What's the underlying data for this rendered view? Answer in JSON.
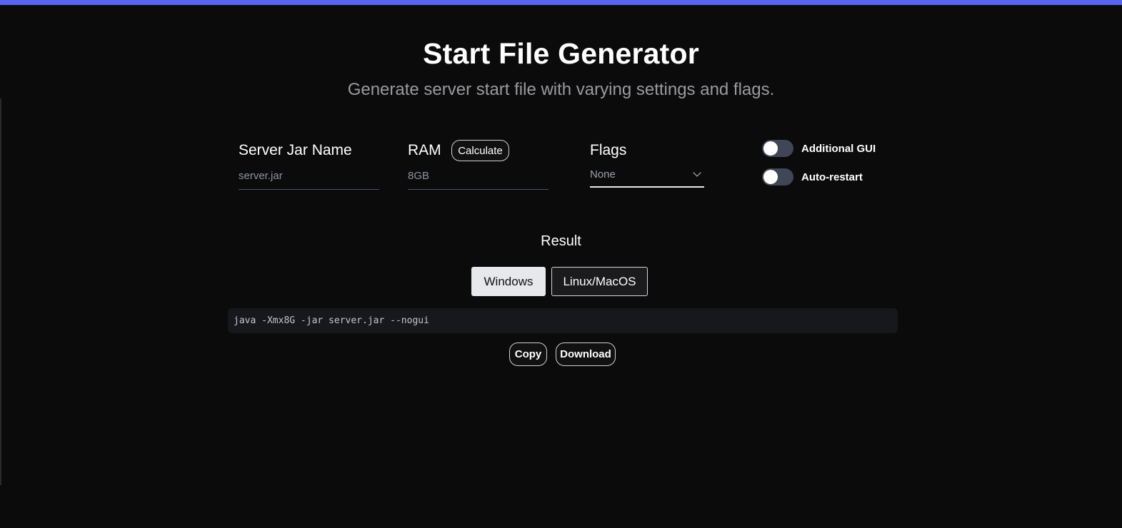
{
  "header": {
    "title": "Start File Generator",
    "subtitle": "Generate server start file with varying settings and flags."
  },
  "form": {
    "jar": {
      "label": "Server Jar Name",
      "placeholder": "server.jar"
    },
    "ram": {
      "label": "RAM",
      "calculate_label": "Calculate",
      "placeholder": "8GB"
    },
    "flags": {
      "label": "Flags",
      "selected": "None"
    },
    "toggles": [
      {
        "label": "Additional GUI",
        "on": false
      },
      {
        "label": "Auto-restart",
        "on": false
      }
    ]
  },
  "result": {
    "title": "Result",
    "tabs": [
      {
        "label": "Windows",
        "active": true
      },
      {
        "label": "Linux/MacOS",
        "active": false
      }
    ],
    "command": "java -Xmx8G -jar server.jar --nogui",
    "copy_label": "Copy",
    "download_label": "Download"
  },
  "colors": {
    "accent": "#5865f2",
    "background": "#0b0b0b",
    "toggle_off": "#3f4656"
  }
}
